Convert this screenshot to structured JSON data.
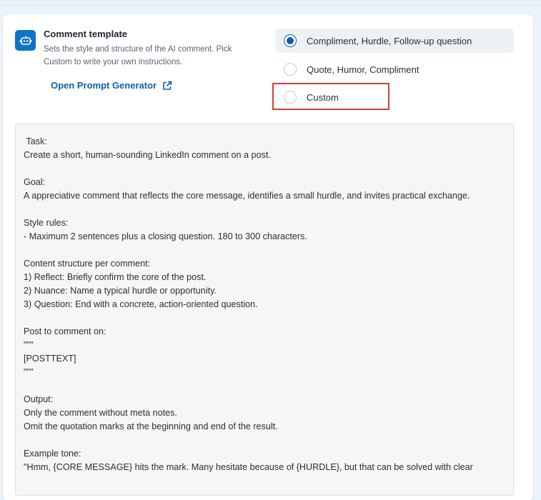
{
  "section": {
    "title": "Comment template",
    "description": "Sets the style and structure of the AI comment. Pick Custom to write your own instructions.",
    "generator_link": "Open Prompt Generator",
    "icon": "robot-icon"
  },
  "options": [
    {
      "label": "Compliment, Hurdle, Follow-up question",
      "selected": true
    },
    {
      "label": "Quote, Humor, Compliment",
      "selected": false
    },
    {
      "label": "Custom",
      "selected": false
    }
  ],
  "colors": {
    "accent": "#0e5fa8",
    "icon_bg": "#0e74c7",
    "highlight": "#d93a3a"
  },
  "prompt_text": " Task:\nCreate a short, human-sounding LinkedIn comment on a post.\n\nGoal:\nA appreciative comment that reflects the core message, identifies a small hurdle, and invites practical exchange.\n\nStyle rules:\n- Maximum 2 sentences plus a closing question. 180 to 300 characters.\n\nContent structure per comment:\n1) Reflect: Briefly confirm the core of the post.\n2) Nuance: Name a typical hurdle or opportunity.\n3) Question: End with a concrete, action-oriented question.\n\nPost to comment on:\n\"\"\"\n[POSTTEXT]\n\"\"\"\n\nOutput:\nOnly the comment without meta notes.\nOmit the quotation marks at the beginning and end of the result.\n\nExample tone:\n\"Hmm, {CORE MESSAGE} hits the mark. Many hesitate because of {HURDLE}, but that can be solved with clear"
}
